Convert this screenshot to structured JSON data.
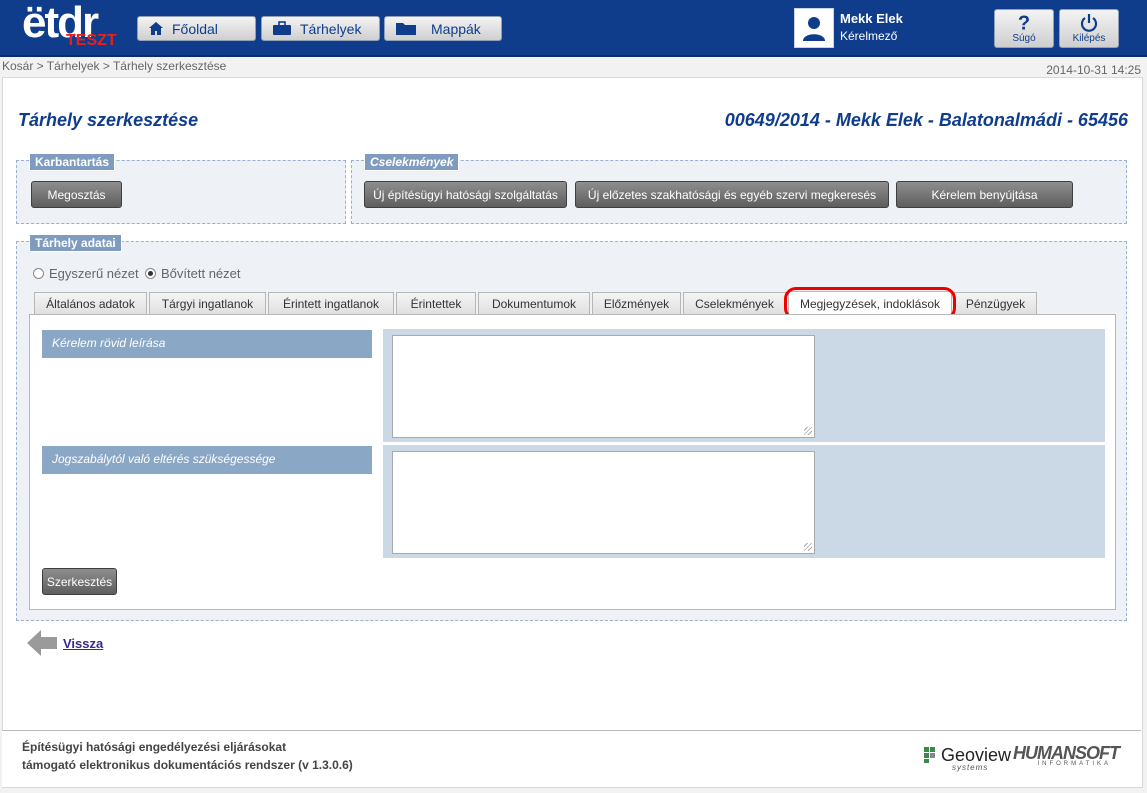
{
  "logo": {
    "text": "ёtdr",
    "badge": "TESZT"
  },
  "nav": {
    "home": "Főoldal",
    "storage": "Tárhelyek",
    "folders": "Mappák"
  },
  "user": {
    "name": "Mekk Elek",
    "role": "Kérelmező"
  },
  "help_label": "Súgó",
  "logout_label": "Kilépés",
  "breadcrumb": "Kosár > Tárhelyek > Tárhely szerkesztése",
  "datetime": "2014-10-31 14:25",
  "page": {
    "title": "Tárhely szerkesztése",
    "reference": "00649/2014 - Mekk Elek - Balatonalmádi - 65456"
  },
  "maintenance": {
    "legend": "Karbantartás",
    "share_button": "Megosztás"
  },
  "actions": {
    "legend": "Cselekmények",
    "buttons": [
      "Új építésügyi hatósági szolgáltatás",
      "Új előzetes szakhatósági és egyéb szervi megkeresés",
      "Kérelem benyújtása"
    ]
  },
  "storage_data": {
    "legend": "Tárhely adatai",
    "view_simple": "Egyszerű nézet",
    "view_extended": "Bővített nézet",
    "tabs": [
      "Általános adatok",
      "Tárgyi ingatlanok",
      "Érintett ingatlanok",
      "Érintettek",
      "Dokumentumok",
      "Előzmények",
      "Cselekmények",
      "Megjegyzések, indoklások",
      "Pénzügyek"
    ],
    "active_tab": "Megjegyzések, indoklások",
    "fields": [
      {
        "label": "Kérelem rövid leírása",
        "value": ""
      },
      {
        "label": "Jogszabálytól való eltérés szükségessége",
        "value": ""
      }
    ],
    "edit_button": "Szerkesztés"
  },
  "back_label": "Vissza",
  "footer": {
    "line1": "Építésügyi hatósági engedélyezési eljárásokat",
    "line2": "támogató elektronikus dokumentációs rendszer (v 1.3.0.6)",
    "geoview": "Geoview",
    "geoview_sub": "systems",
    "humansoft": "HUMANSOFT",
    "humansoft_sub": "INFORMATIKA"
  }
}
